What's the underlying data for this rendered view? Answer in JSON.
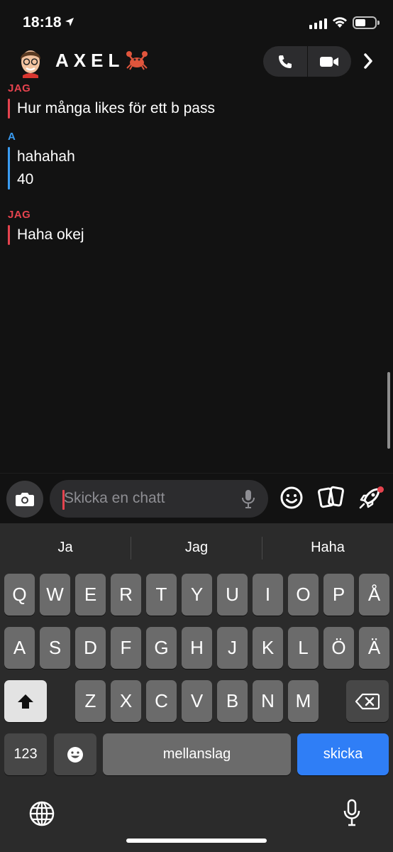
{
  "status_bar": {
    "time": "18:18"
  },
  "header": {
    "contact_name": "AXEL"
  },
  "messages": [
    {
      "sender": "JAG",
      "from": "me",
      "lines": [
        "Hur många likes för ett b pass"
      ]
    },
    {
      "sender": "A",
      "from": "other",
      "lines": [
        "hahahah",
        "40"
      ]
    },
    {
      "sender": "JAG",
      "from": "me",
      "lines": [
        "Haha okej"
      ]
    }
  ],
  "input": {
    "placeholder": "Skicka en chatt"
  },
  "keyboard": {
    "suggestions": [
      "Ja",
      "Jag",
      "Haha"
    ],
    "row1": [
      "Q",
      "W",
      "E",
      "R",
      "T",
      "Y",
      "U",
      "I",
      "O",
      "P",
      "Å"
    ],
    "row2": [
      "A",
      "S",
      "D",
      "F",
      "G",
      "H",
      "J",
      "K",
      "L",
      "Ö",
      "Ä"
    ],
    "row3": [
      "Z",
      "X",
      "C",
      "V",
      "B",
      "N",
      "M"
    ],
    "numbers_label": "123",
    "space_label": "mellanslag",
    "send_label": "skicka"
  },
  "colors": {
    "me": "#e5434e",
    "other": "#3a9cf2",
    "send_key": "#2f7ef6"
  }
}
